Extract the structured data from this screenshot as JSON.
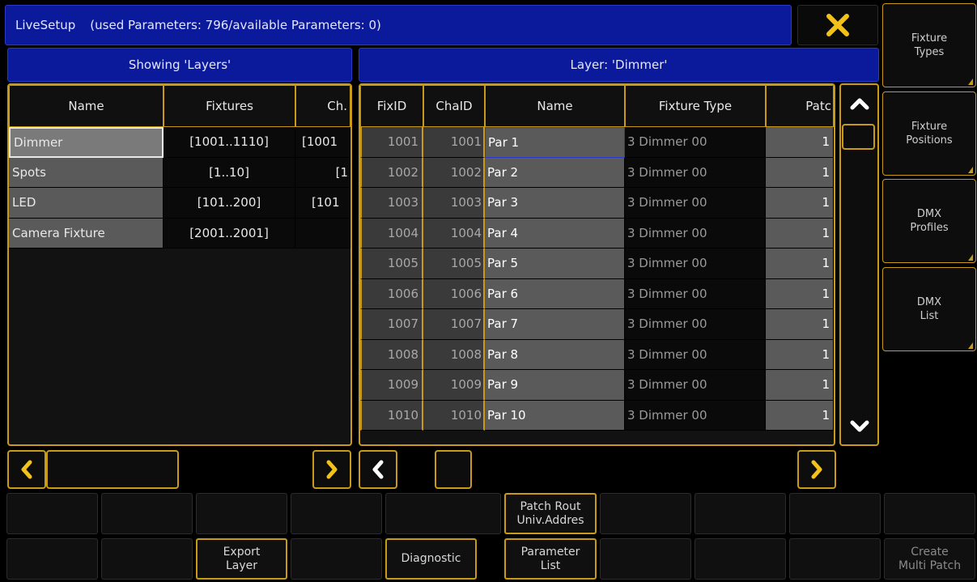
{
  "title": {
    "app": "LiveSetup",
    "info": "(used Parameters: 796/available Parameters: 0)"
  },
  "close_icon": "close-x-icon",
  "left_header": "Showing 'Layers'",
  "right_header": "Layer: 'Dimmer'",
  "side_buttons": [
    {
      "line1": "Fixture",
      "line2": "Types"
    },
    {
      "line1": "Fixture",
      "line2": "Positions"
    },
    {
      "line1": "DMX",
      "line2": "Profiles"
    },
    {
      "line1": "DMX",
      "line2": "List"
    }
  ],
  "layers_table": {
    "columns": [
      "Name",
      "Fixtures",
      "Ch."
    ],
    "rows": [
      {
        "name": "Dimmer",
        "fixtures": "[1001..1110]",
        "ch": "[1001"
      },
      {
        "name": "Spots",
        "fixtures": "[1..10]",
        "ch": "[1"
      },
      {
        "name": "LED",
        "fixtures": "[101..200]",
        "ch": "[101"
      },
      {
        "name": "Camera Fixture",
        "fixtures": "[2001..2001]",
        "ch": ""
      }
    ]
  },
  "fixture_table": {
    "columns": [
      "FixID",
      "ChaID",
      "Name",
      "Fixture Type",
      "Patc"
    ],
    "rows": [
      {
        "fixid": "1001",
        "chaid": "1001",
        "name": "Par 1",
        "type": "3 Dimmer 00",
        "patch": "1"
      },
      {
        "fixid": "1002",
        "chaid": "1002",
        "name": "Par 2",
        "type": "3 Dimmer 00",
        "patch": "1"
      },
      {
        "fixid": "1003",
        "chaid": "1003",
        "name": "Par 3",
        "type": "3 Dimmer 00",
        "patch": "1"
      },
      {
        "fixid": "1004",
        "chaid": "1004",
        "name": "Par 4",
        "type": "3 Dimmer 00",
        "patch": "1"
      },
      {
        "fixid": "1005",
        "chaid": "1005",
        "name": "Par 5",
        "type": "3 Dimmer 00",
        "patch": "1"
      },
      {
        "fixid": "1006",
        "chaid": "1006",
        "name": "Par 6",
        "type": "3 Dimmer 00",
        "patch": "1"
      },
      {
        "fixid": "1007",
        "chaid": "1007",
        "name": "Par 7",
        "type": "3 Dimmer 00",
        "patch": "1"
      },
      {
        "fixid": "1008",
        "chaid": "1008",
        "name": "Par 8",
        "type": "3 Dimmer 00",
        "patch": "1"
      },
      {
        "fixid": "1009",
        "chaid": "1009",
        "name": "Par 9",
        "type": "3 Dimmer 00",
        "patch": "1"
      },
      {
        "fixid": "1010",
        "chaid": "1010",
        "name": "Par 10",
        "type": "3 Dimmer 00",
        "patch": "1"
      }
    ]
  },
  "bottom": {
    "patch_rout": {
      "line1": "Patch Rout",
      "line2": "Univ.Addres"
    },
    "export_layer": {
      "line1": "Export",
      "line2": "Layer"
    },
    "diagnostic": "Diagnostic",
    "parameter_list": {
      "line1": "Parameter",
      "line2": "List"
    },
    "create_multi_patch": {
      "line1": "Create",
      "line2": "Multi Patch"
    }
  },
  "colors": {
    "title_blue": "#0a1a9a",
    "accent_gold": "#c99a17",
    "close_x": "#f2c21b",
    "selected_border": "#2a3ac8"
  }
}
